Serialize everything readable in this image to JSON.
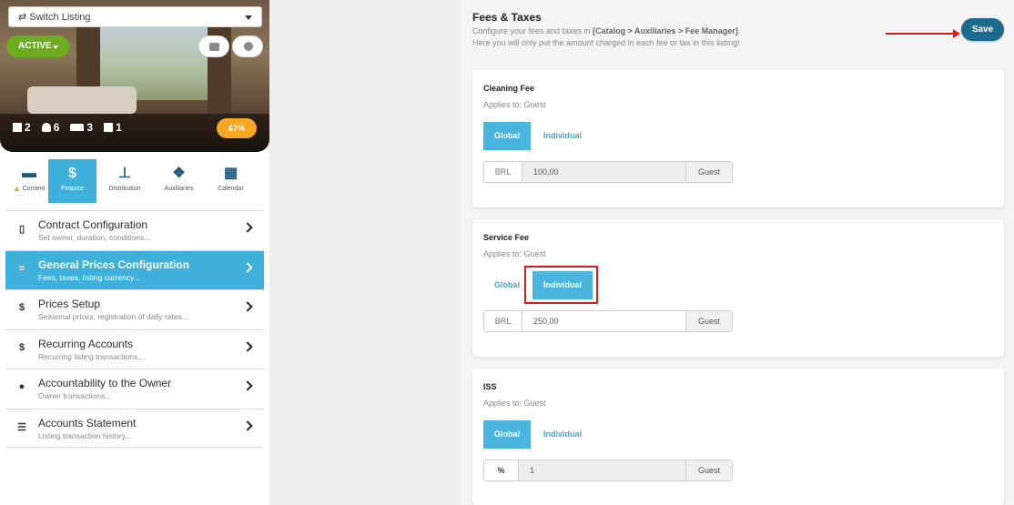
{
  "sidebar": {
    "switch_label": "⇄ Switch Listing",
    "status_label": "ACTIVE",
    "stats": {
      "units": "2",
      "guests": "6",
      "beds": "3",
      "baths": "1"
    },
    "progress": "67%",
    "tabs": [
      {
        "label": "Content",
        "icon": "bed-icon"
      },
      {
        "label": "Finance",
        "icon": "dollar-icon"
      },
      {
        "label": "Distribution",
        "icon": "sitemap-icon"
      },
      {
        "label": "Auxiliaries",
        "icon": "cubes-icon"
      },
      {
        "label": "Calendar",
        "icon": "calendar-icon"
      }
    ],
    "menu": [
      {
        "title": "Contract Configuration",
        "subtitle": "Set owner, duration, conditions...",
        "icon": "document-icon"
      },
      {
        "title": "General Prices Configuration",
        "subtitle": "Fees, taxes, listing currency...",
        "icon": "sliders-icon"
      },
      {
        "title": "Prices Setup",
        "subtitle": "Seasonal prices, registration of daily rates...",
        "icon": "dollar-icon"
      },
      {
        "title": "Recurring Accounts",
        "subtitle": "Recurring listing transactions...",
        "icon": "dollar-icon"
      },
      {
        "title": "Accountability to the Owner",
        "subtitle": "Owner transactions...",
        "icon": "user-icon"
      },
      {
        "title": "Accounts Statement",
        "subtitle": "Listing transaction history...",
        "icon": "list-icon"
      }
    ]
  },
  "main": {
    "title": "Fees & Taxes",
    "desc_pre": "Configure your fees and taxes in ",
    "desc_path": "[Catalog > Auxiliaries > Fee Manager]",
    "desc_post": ".",
    "desc2": "Here you will only put the amount charged in each fee or tax in this listing!",
    "save_label": "Save",
    "cards": [
      {
        "title": "Cleaning Fee",
        "applies": "Applies to: Guest",
        "global_label": "Global",
        "individual_label": "Individual",
        "prefix": "BRL",
        "value": "100,00",
        "suffix": "Guest"
      },
      {
        "title": "Service Fee",
        "applies": "Applies to: Guest",
        "global_label": "Global",
        "individual_label": "Individual",
        "prefix": "BRL",
        "value": "250,00",
        "suffix": "Guest"
      },
      {
        "title": "ISS",
        "applies": "Applies to: Guest",
        "global_label": "Global",
        "individual_label": "Individual",
        "prefix": "%",
        "value": "1",
        "suffix": "Guest"
      }
    ]
  },
  "colors": {
    "accent": "#3fb0db",
    "save": "#1e6a8d",
    "active_badge": "#6eac1f",
    "progress": "#f5a623",
    "annotation": "#d71a1a"
  }
}
